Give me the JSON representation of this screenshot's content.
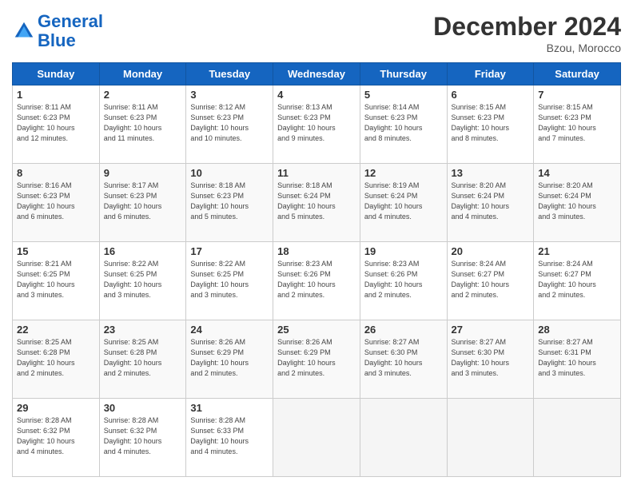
{
  "header": {
    "logo_line1": "General",
    "logo_line2": "Blue",
    "month": "December 2024",
    "location": "Bzou, Morocco"
  },
  "weekdays": [
    "Sunday",
    "Monday",
    "Tuesday",
    "Wednesday",
    "Thursday",
    "Friday",
    "Saturday"
  ],
  "weeks": [
    [
      {
        "day": "1",
        "info": "Sunrise: 8:11 AM\nSunset: 6:23 PM\nDaylight: 10 hours\nand 12 minutes."
      },
      {
        "day": "2",
        "info": "Sunrise: 8:11 AM\nSunset: 6:23 PM\nDaylight: 10 hours\nand 11 minutes."
      },
      {
        "day": "3",
        "info": "Sunrise: 8:12 AM\nSunset: 6:23 PM\nDaylight: 10 hours\nand 10 minutes."
      },
      {
        "day": "4",
        "info": "Sunrise: 8:13 AM\nSunset: 6:23 PM\nDaylight: 10 hours\nand 9 minutes."
      },
      {
        "day": "5",
        "info": "Sunrise: 8:14 AM\nSunset: 6:23 PM\nDaylight: 10 hours\nand 8 minutes."
      },
      {
        "day": "6",
        "info": "Sunrise: 8:15 AM\nSunset: 6:23 PM\nDaylight: 10 hours\nand 8 minutes."
      },
      {
        "day": "7",
        "info": "Sunrise: 8:15 AM\nSunset: 6:23 PM\nDaylight: 10 hours\nand 7 minutes."
      }
    ],
    [
      {
        "day": "8",
        "info": "Sunrise: 8:16 AM\nSunset: 6:23 PM\nDaylight: 10 hours\nand 6 minutes."
      },
      {
        "day": "9",
        "info": "Sunrise: 8:17 AM\nSunset: 6:23 PM\nDaylight: 10 hours\nand 6 minutes."
      },
      {
        "day": "10",
        "info": "Sunrise: 8:18 AM\nSunset: 6:23 PM\nDaylight: 10 hours\nand 5 minutes."
      },
      {
        "day": "11",
        "info": "Sunrise: 8:18 AM\nSunset: 6:24 PM\nDaylight: 10 hours\nand 5 minutes."
      },
      {
        "day": "12",
        "info": "Sunrise: 8:19 AM\nSunset: 6:24 PM\nDaylight: 10 hours\nand 4 minutes."
      },
      {
        "day": "13",
        "info": "Sunrise: 8:20 AM\nSunset: 6:24 PM\nDaylight: 10 hours\nand 4 minutes."
      },
      {
        "day": "14",
        "info": "Sunrise: 8:20 AM\nSunset: 6:24 PM\nDaylight: 10 hours\nand 3 minutes."
      }
    ],
    [
      {
        "day": "15",
        "info": "Sunrise: 8:21 AM\nSunset: 6:25 PM\nDaylight: 10 hours\nand 3 minutes."
      },
      {
        "day": "16",
        "info": "Sunrise: 8:22 AM\nSunset: 6:25 PM\nDaylight: 10 hours\nand 3 minutes."
      },
      {
        "day": "17",
        "info": "Sunrise: 8:22 AM\nSunset: 6:25 PM\nDaylight: 10 hours\nand 3 minutes."
      },
      {
        "day": "18",
        "info": "Sunrise: 8:23 AM\nSunset: 6:26 PM\nDaylight: 10 hours\nand 2 minutes."
      },
      {
        "day": "19",
        "info": "Sunrise: 8:23 AM\nSunset: 6:26 PM\nDaylight: 10 hours\nand 2 minutes."
      },
      {
        "day": "20",
        "info": "Sunrise: 8:24 AM\nSunset: 6:27 PM\nDaylight: 10 hours\nand 2 minutes."
      },
      {
        "day": "21",
        "info": "Sunrise: 8:24 AM\nSunset: 6:27 PM\nDaylight: 10 hours\nand 2 minutes."
      }
    ],
    [
      {
        "day": "22",
        "info": "Sunrise: 8:25 AM\nSunset: 6:28 PM\nDaylight: 10 hours\nand 2 minutes."
      },
      {
        "day": "23",
        "info": "Sunrise: 8:25 AM\nSunset: 6:28 PM\nDaylight: 10 hours\nand 2 minutes."
      },
      {
        "day": "24",
        "info": "Sunrise: 8:26 AM\nSunset: 6:29 PM\nDaylight: 10 hours\nand 2 minutes."
      },
      {
        "day": "25",
        "info": "Sunrise: 8:26 AM\nSunset: 6:29 PM\nDaylight: 10 hours\nand 2 minutes."
      },
      {
        "day": "26",
        "info": "Sunrise: 8:27 AM\nSunset: 6:30 PM\nDaylight: 10 hours\nand 3 minutes."
      },
      {
        "day": "27",
        "info": "Sunrise: 8:27 AM\nSunset: 6:30 PM\nDaylight: 10 hours\nand 3 minutes."
      },
      {
        "day": "28",
        "info": "Sunrise: 8:27 AM\nSunset: 6:31 PM\nDaylight: 10 hours\nand 3 minutes."
      }
    ],
    [
      {
        "day": "29",
        "info": "Sunrise: 8:28 AM\nSunset: 6:32 PM\nDaylight: 10 hours\nand 4 minutes."
      },
      {
        "day": "30",
        "info": "Sunrise: 8:28 AM\nSunset: 6:32 PM\nDaylight: 10 hours\nand 4 minutes."
      },
      {
        "day": "31",
        "info": "Sunrise: 8:28 AM\nSunset: 6:33 PM\nDaylight: 10 hours\nand 4 minutes."
      },
      null,
      null,
      null,
      null
    ]
  ]
}
